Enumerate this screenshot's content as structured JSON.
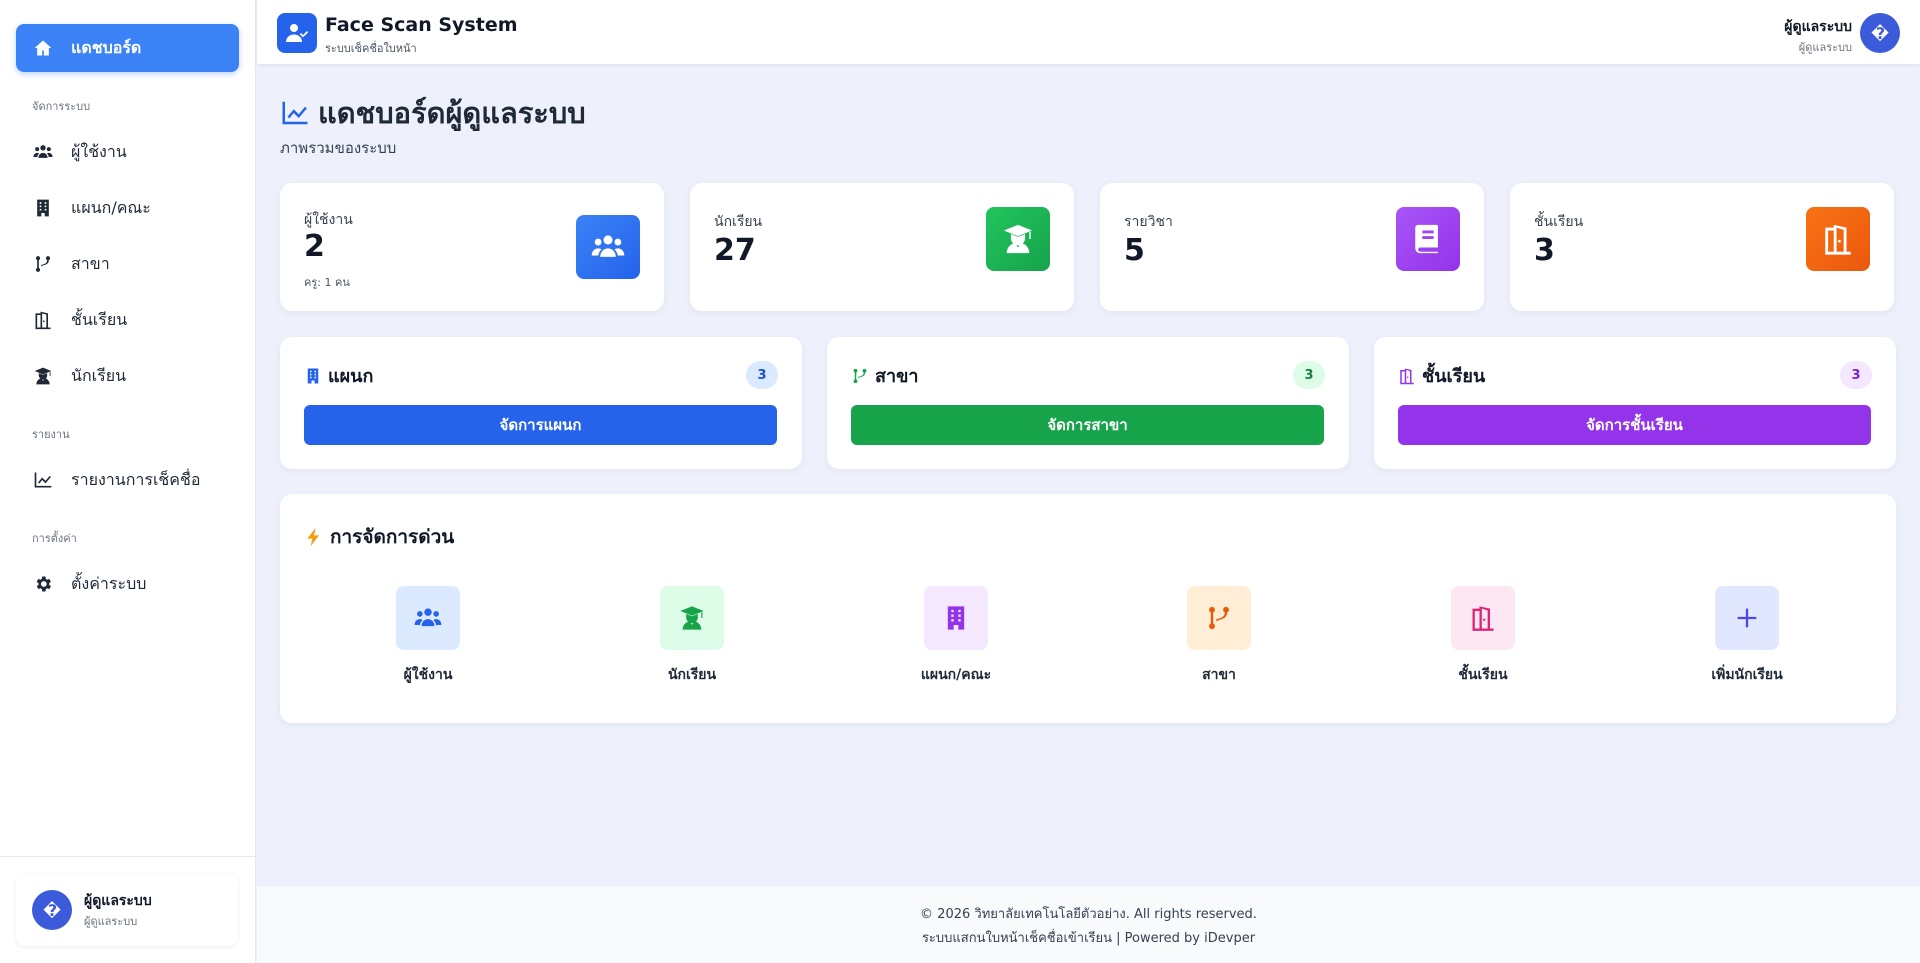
{
  "sidebar": {
    "items": [
      {
        "label": "แดชบอร์ด",
        "icon": "home-icon"
      },
      {
        "label": "ผู้ใช้งาน",
        "icon": "users-icon"
      },
      {
        "label": "แผนก/คณะ",
        "icon": "building-icon"
      },
      {
        "label": "สาขา",
        "icon": "branch-icon"
      },
      {
        "label": "ชั้นเรียน",
        "icon": "door-icon"
      },
      {
        "label": "นักเรียน",
        "icon": "student-icon"
      },
      {
        "label": "รายงานการเช็คชื่อ",
        "icon": "chart-line-icon"
      },
      {
        "label": "ตั้งค่าระบบ",
        "icon": "gear-icon"
      }
    ],
    "sections": [
      "จัดการระบบ",
      "รายงาน",
      "การตั้งค่า"
    ],
    "user": {
      "name": "ผู้ดูแลระบบ",
      "role": "ผู้ดูแลระบบ",
      "avatar": "�"
    }
  },
  "header": {
    "title": "Face Scan System",
    "subtitle": "ระบบเช็คชื่อใบหน้า",
    "user_name": "ผู้ดูแลระบบ",
    "user_role": "ผู้ดูแลระบบ",
    "avatar": "�"
  },
  "page": {
    "title": "แดชบอร์ดผู้ดูแลระบบ",
    "subtitle": "ภาพรวมของระบบ"
  },
  "stats": [
    {
      "label": "ผู้ใช้งาน",
      "value": "2",
      "note": "ครู: 1 คน",
      "color": "#3b82f6",
      "icon": "users-icon"
    },
    {
      "label": "นักเรียน",
      "value": "27",
      "color": "#22c55e",
      "icon": "student-icon"
    },
    {
      "label": "รายวิชา",
      "value": "5",
      "color": "#a855f7",
      "icon": "book-icon"
    },
    {
      "label": "ชั้นเรียน",
      "value": "3",
      "color": "#f97316",
      "icon": "door-icon"
    }
  ],
  "management": [
    {
      "title": "แผนก",
      "count": "3",
      "button": "จัดการแผนก",
      "color": "#2563eb",
      "icon": "building-icon"
    },
    {
      "title": "สาขา",
      "count": "3",
      "button": "จัดการสาขา",
      "color": "#16a34a",
      "icon": "branch-icon"
    },
    {
      "title": "ชั้นเรียน",
      "count": "3",
      "button": "จัดการชั้นเรียน",
      "color": "#9333ea",
      "icon": "door-icon"
    }
  ],
  "quick": {
    "title": "การจัดการด่วน",
    "actions": [
      {
        "label": "ผู้ใช้งาน",
        "icon": "users-icon"
      },
      {
        "label": "นักเรียน",
        "icon": "student-icon"
      },
      {
        "label": "แผนก/คณะ",
        "icon": "building-icon"
      },
      {
        "label": "สาขา",
        "icon": "branch-icon"
      },
      {
        "label": "ชั้นเรียน",
        "icon": "door-icon"
      },
      {
        "label": "เพิ่มนักเรียน",
        "icon": "plus-icon"
      }
    ]
  },
  "footer": {
    "line1": "© 2026 วิทยาลัยเทคโนโลยีตัวอย่าง. All rights reserved.",
    "line2": "ระบบแสกนใบหน้าเช็คชื่อเข้าเรียน | Powered by iDevper"
  }
}
